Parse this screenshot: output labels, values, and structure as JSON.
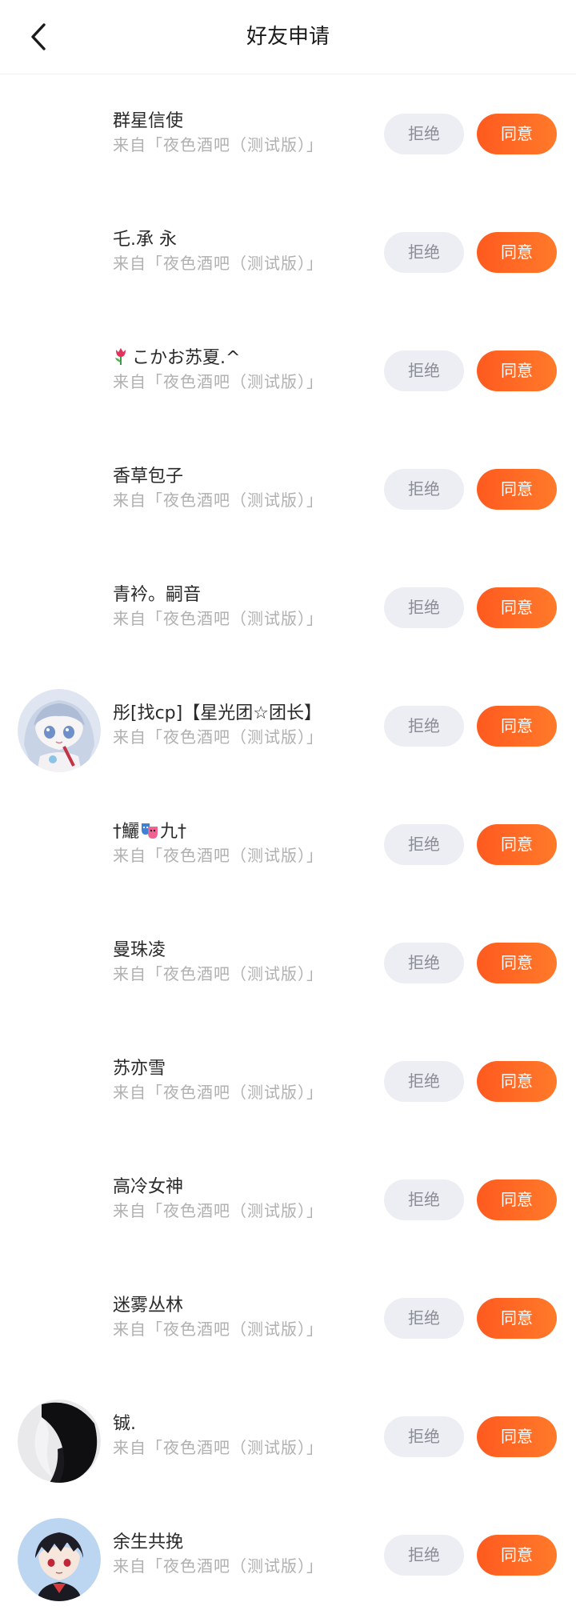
{
  "header": {
    "title": "好友申请",
    "back_icon": "chevron-left-icon"
  },
  "colors": {
    "accept": "#ff6a24",
    "reject_bg": "#eceef3",
    "source_text": "#b0b0b0"
  },
  "requests": [
    {
      "name": "群星信使",
      "source": "来自「夜色酒吧（测试版）」",
      "reject_label": "拒绝",
      "accept_label": "同意"
    },
    {
      "name": "乇.承 永",
      "source": "来自「夜色酒吧（测试版）」",
      "reject_label": "拒绝",
      "accept_label": "同意"
    },
    {
      "name": "こかお苏夏.^",
      "name_prefix_icon": "tulip-emoji",
      "source": "来自「夜色酒吧（测试版）」",
      "reject_label": "拒绝",
      "accept_label": "同意"
    },
    {
      "name": "香草包子",
      "source": "来自「夜色酒吧（测试版）」",
      "reject_label": "拒绝",
      "accept_label": "同意"
    },
    {
      "name": "青衿。嗣音",
      "source": "来自「夜色酒吧（测试版）」",
      "reject_label": "拒绝",
      "accept_label": "同意"
    },
    {
      "name": "彤[找cp]【星光团☆团长】",
      "source": "来自「夜色酒吧（测试版）」",
      "reject_label": "拒绝",
      "accept_label": "同意",
      "avatar": "anime-girl-avatar"
    },
    {
      "name_part1": "†鱺",
      "name_part2": "九†",
      "name_mid_icon": "performing-arts-emoji",
      "source": "来自「夜色酒吧（测试版）」",
      "reject_label": "拒绝",
      "accept_label": "同意"
    },
    {
      "name": "曼珠凌",
      "source": "来自「夜色酒吧（测试版）」",
      "reject_label": "拒绝",
      "accept_label": "同意"
    },
    {
      "name": "苏亦雪",
      "source": "来自「夜色酒吧（测试版）」",
      "reject_label": "拒绝",
      "accept_label": "同意"
    },
    {
      "name": "高冷女神",
      "source": "来自「夜色酒吧（测试版）」",
      "reject_label": "拒绝",
      "accept_label": "同意"
    },
    {
      "name": "迷雾丛林",
      "source": "来自「夜色酒吧（测试版）」",
      "reject_label": "拒绝",
      "accept_label": "同意"
    },
    {
      "name": "铖.",
      "source": "来自「夜色酒吧（测试版）」",
      "reject_label": "拒绝",
      "accept_label": "同意",
      "avatar": "dark-hair-avatar"
    },
    {
      "name": "余生共挽",
      "source": "来自「夜色酒吧（测试版）」",
      "reject_label": "拒绝",
      "accept_label": "同意",
      "avatar": "anime-boy-avatar"
    }
  ]
}
